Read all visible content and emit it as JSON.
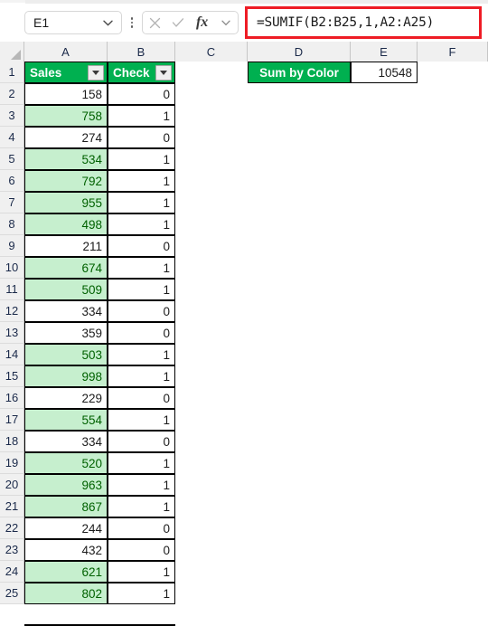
{
  "formula_bar": {
    "name_box_value": "E1",
    "name_box_chevron_icon": "chevron-down-icon",
    "kebab_icon": "more-options-icon",
    "cancel_icon": "close-icon",
    "confirm_icon": "checkmark-icon",
    "function_icon": "fx-icon",
    "expand_icon": "chevron-down-icon",
    "formula": "=SUMIF(B2:B25,1,A2:A25)",
    "highlight_color": "#ee1c25"
  },
  "grid": {
    "select_all_icon": "select-all-corner-icon",
    "column_headers": [
      "A",
      "B",
      "C",
      "D",
      "E",
      "F"
    ],
    "row_headers": [
      "1",
      "2",
      "3",
      "4",
      "5",
      "6",
      "7",
      "8",
      "9",
      "10",
      "11",
      "12",
      "13",
      "14",
      "15",
      "16",
      "17",
      "18",
      "19",
      "20",
      "21",
      "22",
      "23",
      "24",
      "25"
    ],
    "header_fill": "#00b050",
    "header_text_color": "#ffffff",
    "green_cell_fill": "#c6efce",
    "green_cell_text": "#006100",
    "table_header": {
      "a1": "Sales",
      "b1": "Check",
      "filter_icon": "filter-dropdown-icon"
    },
    "summary": {
      "label": "Sum by Color",
      "value": "10548"
    },
    "rows": [
      {
        "row": "2",
        "sales": "158",
        "check": "0",
        "highlight": false
      },
      {
        "row": "3",
        "sales": "758",
        "check": "1",
        "highlight": true
      },
      {
        "row": "4",
        "sales": "274",
        "check": "0",
        "highlight": false
      },
      {
        "row": "5",
        "sales": "534",
        "check": "1",
        "highlight": true
      },
      {
        "row": "6",
        "sales": "792",
        "check": "1",
        "highlight": true
      },
      {
        "row": "7",
        "sales": "955",
        "check": "1",
        "highlight": true
      },
      {
        "row": "8",
        "sales": "498",
        "check": "1",
        "highlight": true
      },
      {
        "row": "9",
        "sales": "211",
        "check": "0",
        "highlight": false
      },
      {
        "row": "10",
        "sales": "674",
        "check": "1",
        "highlight": true
      },
      {
        "row": "11",
        "sales": "509",
        "check": "1",
        "highlight": true
      },
      {
        "row": "12",
        "sales": "334",
        "check": "0",
        "highlight": false
      },
      {
        "row": "13",
        "sales": "359",
        "check": "0",
        "highlight": false
      },
      {
        "row": "14",
        "sales": "503",
        "check": "1",
        "highlight": true
      },
      {
        "row": "15",
        "sales": "998",
        "check": "1",
        "highlight": true
      },
      {
        "row": "16",
        "sales": "229",
        "check": "0",
        "highlight": false
      },
      {
        "row": "17",
        "sales": "554",
        "check": "1",
        "highlight": true
      },
      {
        "row": "18",
        "sales": "334",
        "check": "0",
        "highlight": false
      },
      {
        "row": "19",
        "sales": "520",
        "check": "1",
        "highlight": true
      },
      {
        "row": "20",
        "sales": "963",
        "check": "1",
        "highlight": true
      },
      {
        "row": "21",
        "sales": "867",
        "check": "1",
        "highlight": true
      },
      {
        "row": "22",
        "sales": "244",
        "check": "0",
        "highlight": false
      },
      {
        "row": "23",
        "sales": "432",
        "check": "0",
        "highlight": false
      },
      {
        "row": "24",
        "sales": "621",
        "check": "1",
        "highlight": true
      },
      {
        "row": "25",
        "sales": "802",
        "check": "1",
        "highlight": true
      }
    ]
  }
}
